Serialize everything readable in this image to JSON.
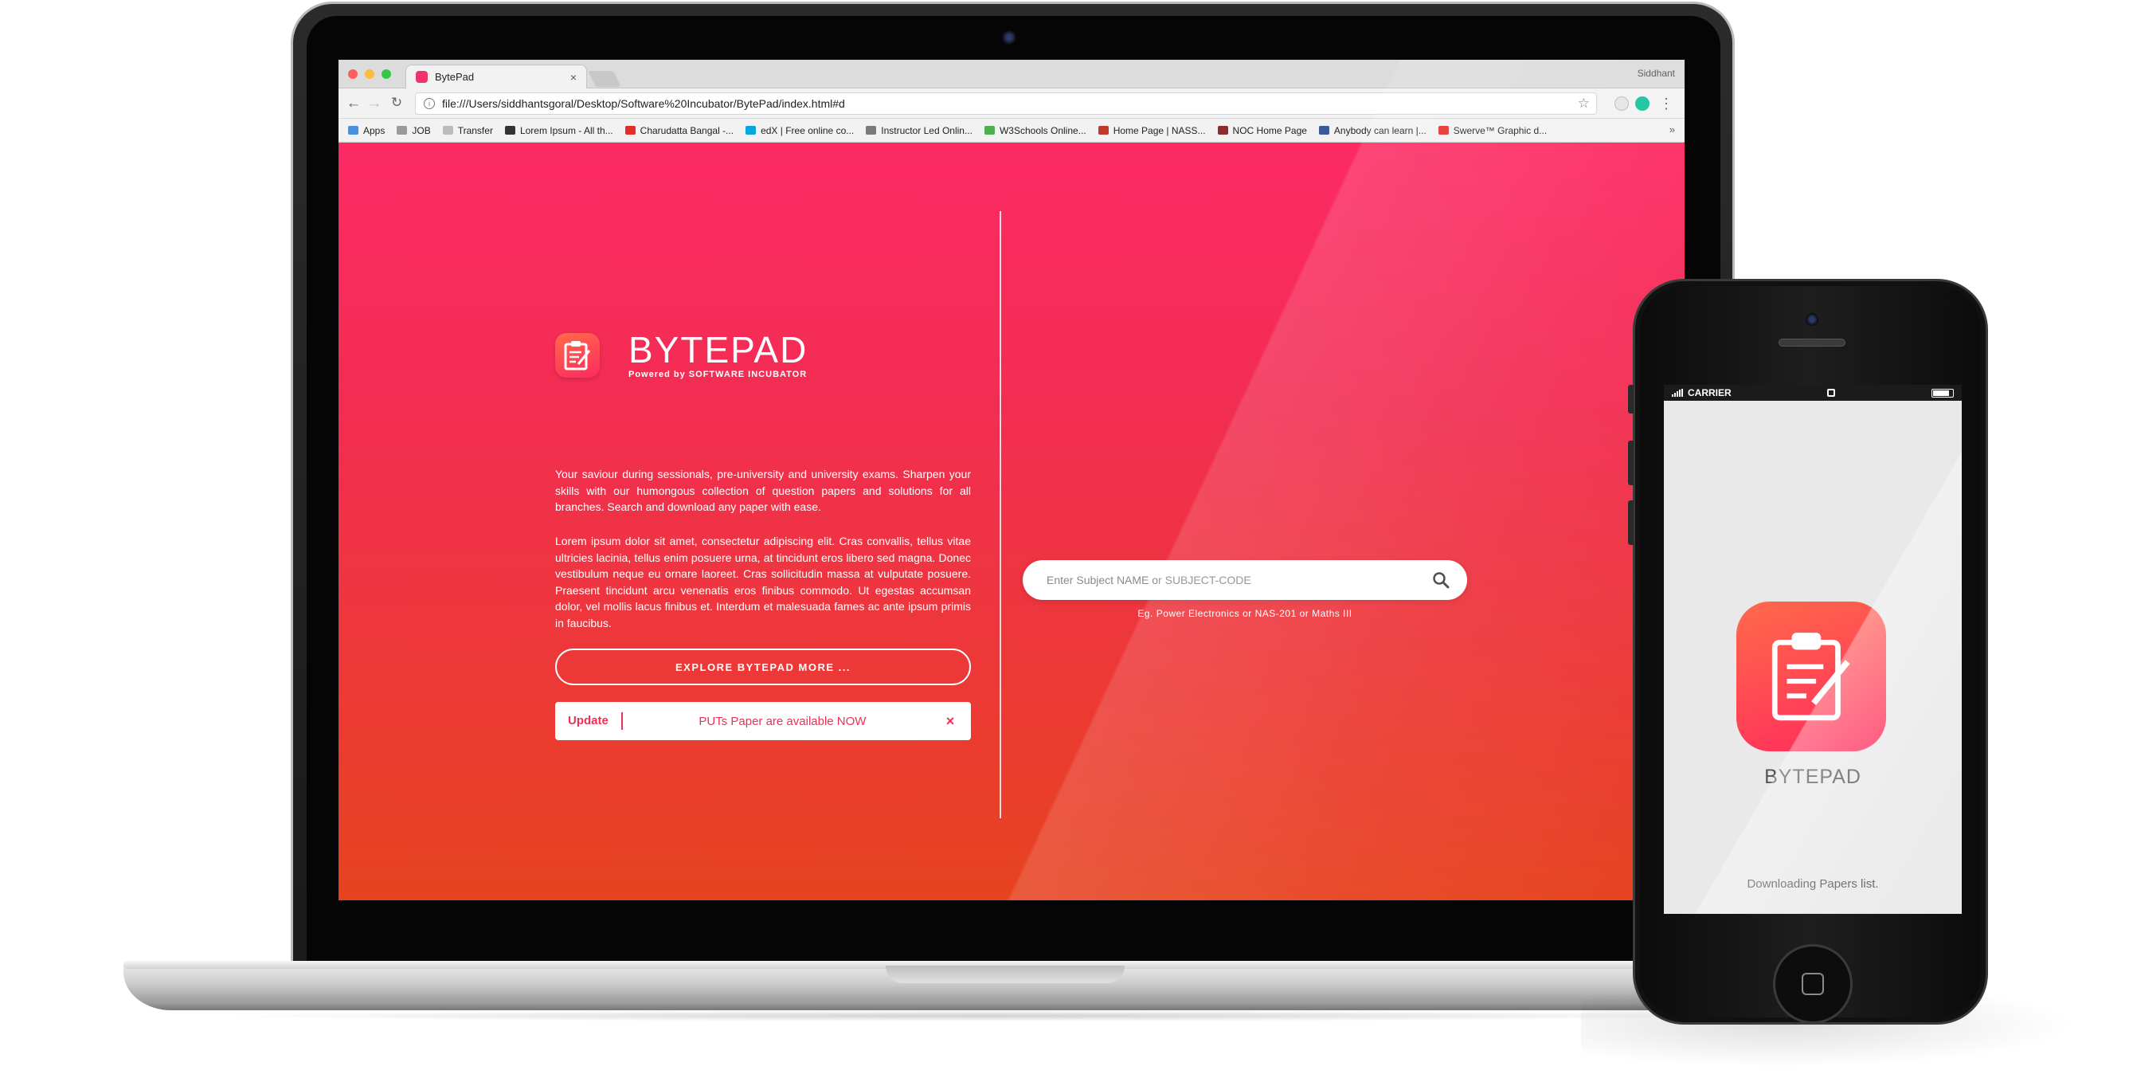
{
  "browser": {
    "tab_title": "BytePad",
    "tab_close": "×",
    "profile_name": "Siddhant",
    "url": "file:///Users/siddhantsgoral/Desktop/Software%20Incubator/BytePad/index.html#d",
    "bookmarks": [
      {
        "label": "Apps",
        "icon_color": "#4a90e2"
      },
      {
        "label": "JOB",
        "icon_color": "#9a9a9a"
      },
      {
        "label": "Transfer",
        "icon_color": "#bbbbbb"
      },
      {
        "label": "Lorem Ipsum - All th...",
        "icon_color": "#333333"
      },
      {
        "label": "Charudatta Bangal -...",
        "icon_color": "#e52d27"
      },
      {
        "label": "edX | Free online co...",
        "icon_color": "#02a7e0"
      },
      {
        "label": "Instructor Led Onlin...",
        "icon_color": "#7a7a7a"
      },
      {
        "label": "W3Schools Online...",
        "icon_color": "#4caf50"
      },
      {
        "label": "Home Page | NASS...",
        "icon_color": "#c0392b"
      },
      {
        "label": "NOC Home Page",
        "icon_color": "#8e2b2b"
      },
      {
        "label": "Anybody can learn |...",
        "icon_color": "#3b5998"
      },
      {
        "label": "Swerve™ Graphic d...",
        "icon_color": "#e52d27"
      }
    ],
    "bookmarks_more": "»"
  },
  "page": {
    "brand_name": "BYTEPAD",
    "brand_sub": "Powered by SOFTWARE INCUBATOR",
    "intro": "Your saviour during sessionals, pre-university and university exams. Sharpen your skills with our humongous collection of question papers and solutions for all branches. Search and download any paper with ease.",
    "lorem": "Lorem ipsum dolor sit amet, consectetur adipiscing elit. Cras convallis, tellus vitae ultricies lacinia, tellus enim posuere urna, at tincidunt eros libero sed magna. Donec vestibulum neque eu ornare laoreet. Cras sollicitudin massa at vulputate posuere. Praesent tincidunt arcu venenatis eros finibus commodo. Ut egestas accumsan dolor, vel mollis lacus finibus et. Interdum et malesuada fames ac ante ipsum primis in faucibus.",
    "explore_button": "EXPLORE BYTEPAD MORE ...",
    "update_label": "Update",
    "update_message": "PUTs Paper are available NOW",
    "update_close": "×",
    "search_placeholder": "Enter Subject NAME or SUBJECT-CODE",
    "search_hint": "Eg. Power Electronics or NAS-201 or Maths III"
  },
  "phone": {
    "carrier": "CARRIER",
    "app_name": "BYTEPAD",
    "status_text": "Downloading Papers list."
  },
  "colors": {
    "accent": "#f12f55",
    "gradient_top": "#fd2a63",
    "gradient_bottom": "#e6431f"
  }
}
